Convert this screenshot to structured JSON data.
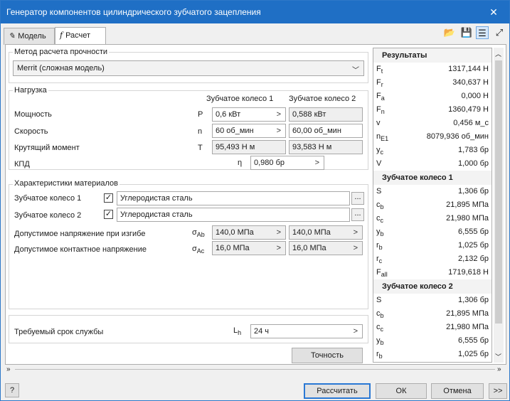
{
  "window": {
    "title": "Генератор компонентов цилиндрического зубчатого зацепления",
    "close_glyph": "✕"
  },
  "tabs": [
    {
      "label": "Модель",
      "icon": "model-icon"
    },
    {
      "label": "Расчет",
      "icon": "function-icon"
    }
  ],
  "toolbar_icons": [
    "folder-open-icon",
    "save-icon",
    "settings-icon",
    "expand-icon"
  ],
  "method": {
    "group_label": "Метод расчета прочности",
    "selected": "Merrit (сложная модель)"
  },
  "load": {
    "group_label": "Нагрузка",
    "col_gear1": "Зубчатое колесо 1",
    "col_gear2": "Зубчатое колесо 2",
    "rows": [
      {
        "label": "Мощность",
        "symbol": "P",
        "gear1": "0,6 кВт",
        "gear2": "0,588 кВт"
      },
      {
        "label": "Скорость",
        "symbol": "n",
        "gear1": "60 об_мин",
        "gear2": "60,00 об_мин"
      },
      {
        "label": "Крутящий момент",
        "symbol": "T",
        "gear1": "95,493 Н м",
        "gear2": "93,583 Н м"
      }
    ],
    "efficiency": {
      "label": "КПД",
      "symbol": "η",
      "value": "0,980 бр"
    }
  },
  "materials": {
    "group_label": "Характеристики материалов",
    "gear1_label": "Зубчатое колесо 1",
    "gear1_material": "Углеродистая сталь",
    "gear2_label": "Зубчатое колесо 2",
    "gear2_material": "Углеродистая сталь",
    "dots": "...",
    "bending": {
      "label": "Допустимое напряжение при изгибе",
      "symbol": "σ",
      "sub": "Ab",
      "gear1": "140,0 МПа",
      "gear2": "140,0 МПа"
    },
    "contact": {
      "label": "Допустимое контактное напряжение",
      "symbol": "σ",
      "sub": "Ac",
      "gear1": "16,0 МПа",
      "gear2": "16,0 МПа"
    }
  },
  "service_life": {
    "label": "Требуемый срок службы",
    "symbol": "L",
    "sub": "h",
    "value": "24 ч"
  },
  "accuracy_button": "Точность",
  "results": {
    "header": "Результаты",
    "main": [
      {
        "k": "F",
        "s": "t",
        "v": "1317,144 Н"
      },
      {
        "k": "F",
        "s": "r",
        "v": "340,637 Н"
      },
      {
        "k": "F",
        "s": "a",
        "v": "0,000 Н"
      },
      {
        "k": "F",
        "s": "n",
        "v": "1360,479 Н"
      },
      {
        "k": "v",
        "s": "",
        "v": "0,456 м_с"
      },
      {
        "k": "n",
        "s": "E1",
        "v": "8079,936 об_мин"
      },
      {
        "k": "y",
        "s": "c",
        "v": "1,783 бр"
      },
      {
        "k": "V",
        "s": "",
        "v": "1,000 бр"
      }
    ],
    "gear1_header": "Зубчатое колесо 1",
    "gear1": [
      {
        "k": "S",
        "s": "",
        "v": "1,306 бр"
      },
      {
        "k": "c",
        "s": "b",
        "v": "21,895 МПа"
      },
      {
        "k": "c",
        "s": "c",
        "v": "21,980 МПа"
      },
      {
        "k": "y",
        "s": "b",
        "v": "6,555 бр"
      },
      {
        "k": "r",
        "s": "b",
        "v": "1,025 бр"
      },
      {
        "k": "r",
        "s": "c",
        "v": "2,132 бр"
      },
      {
        "k": "F",
        "s": "all",
        "v": "1719,618 Н"
      }
    ],
    "gear2_header": "Зубчатое колесо 2",
    "gear2": [
      {
        "k": "S",
        "s": "",
        "v": "1,306 бр"
      },
      {
        "k": "c",
        "s": "b",
        "v": "21,895 МПа"
      },
      {
        "k": "c",
        "s": "c",
        "v": "21,980 МПа"
      },
      {
        "k": "y",
        "s": "b",
        "v": "6,555 бр"
      },
      {
        "k": "r",
        "s": "b",
        "v": "1,025 бр"
      }
    ]
  },
  "footer": {
    "help": "?",
    "calculate": "Рассчитать",
    "ok": "ОК",
    "cancel": "Отмена",
    "more": ">>"
  }
}
